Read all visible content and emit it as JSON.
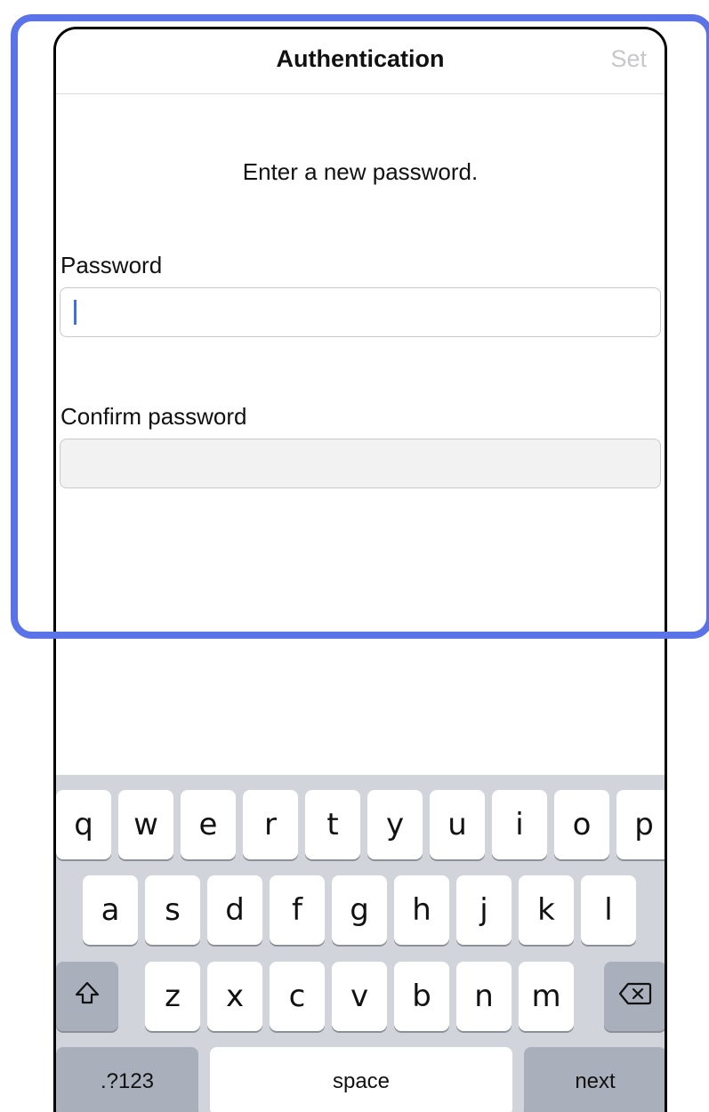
{
  "nav": {
    "title": "Authentication",
    "action_label": "Set"
  },
  "instruction": "Enter a new password.",
  "fields": {
    "password": {
      "label": "Password",
      "value": ""
    },
    "confirm_password": {
      "label": "Confirm password",
      "value": ""
    }
  },
  "keyboard": {
    "row1": [
      "q",
      "w",
      "e",
      "r",
      "t",
      "y",
      "u",
      "i",
      "o",
      "p"
    ],
    "row2": [
      "a",
      "s",
      "d",
      "f",
      "g",
      "h",
      "j",
      "k",
      "l"
    ],
    "row3": [
      "z",
      "x",
      "c",
      "v",
      "b",
      "n",
      "m"
    ],
    "shift_icon": "shift-icon",
    "delete_icon": "delete-icon",
    "numbers_label": ".?123",
    "space_label": "space",
    "next_label": "next"
  },
  "colors": {
    "highlight": "#5b73e8",
    "caret": "#3b6ff0",
    "disabled_action": "#c7c7cc",
    "keyboard_bg": "#d1d4da"
  }
}
